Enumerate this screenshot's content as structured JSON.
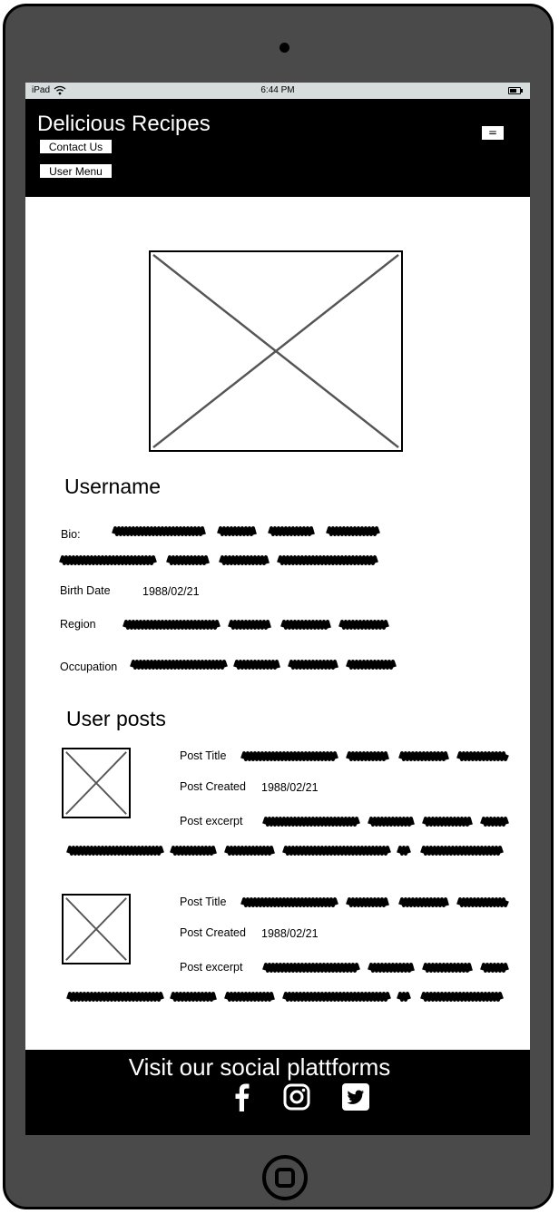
{
  "statusbar": {
    "device": "iPad",
    "time": "6:44 PM"
  },
  "header": {
    "title": "Delicious Recipes",
    "contact_label": "Contact Us",
    "user_menu_label": "User Menu",
    "menu_icon": "="
  },
  "profile": {
    "username": "Username",
    "bio_label": "Bio:",
    "birth_label": "Birth Date",
    "birth_value": "1988/02/21",
    "region_label": "Region",
    "occupation_label": "Occupation"
  },
  "posts": {
    "heading": "User posts",
    "items": [
      {
        "title_label": "Post Title",
        "created_label": "Post Created",
        "created_value": "1988/02/21",
        "excerpt_label": "Post excerpt"
      },
      {
        "title_label": "Post Title",
        "created_label": "Post Created",
        "created_value": "1988/02/21",
        "excerpt_label": "Post excerpt"
      }
    ]
  },
  "footer": {
    "title": "Visit our social plattforms",
    "icons": [
      "facebook-icon",
      "instagram-icon",
      "twitter-icon"
    ]
  },
  "colors": {
    "device": "#4a4a4a",
    "header": "#000000",
    "statusbar": "#d7dcdc"
  }
}
